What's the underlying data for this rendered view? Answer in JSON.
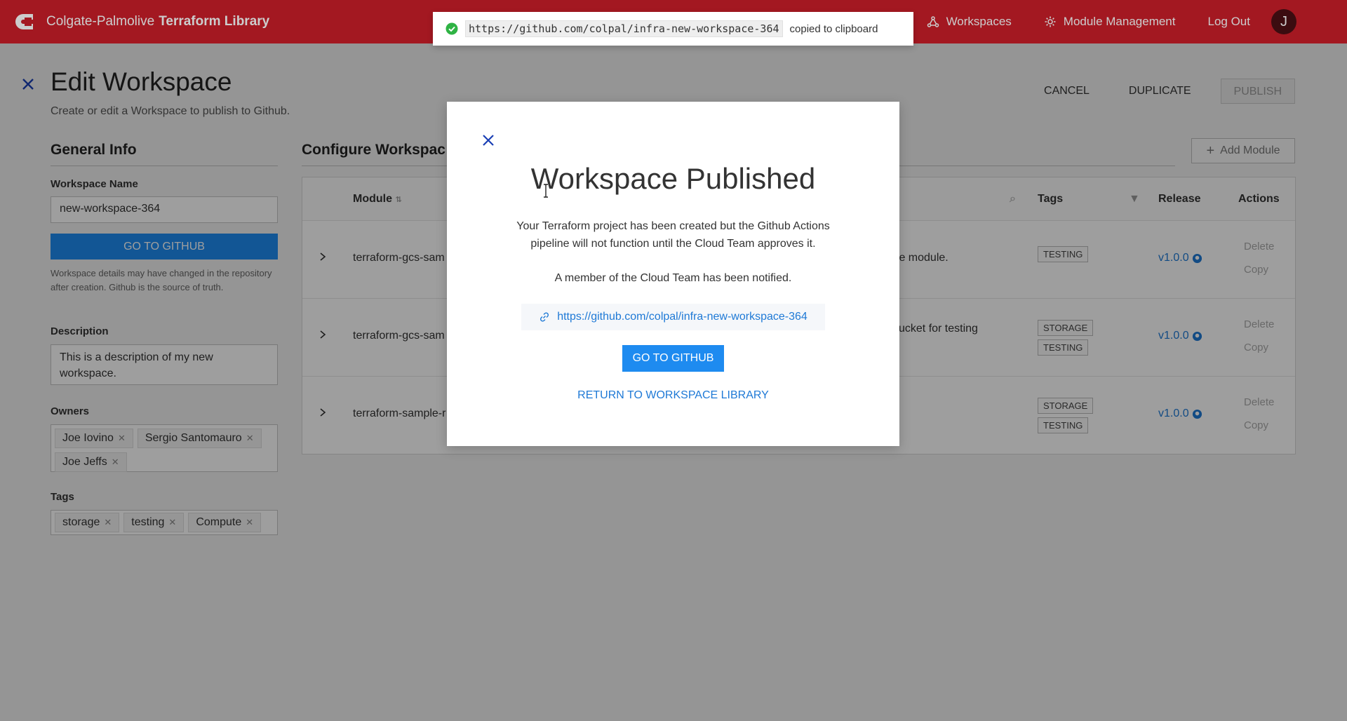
{
  "header": {
    "brand_prefix": "Colgate-Palmolive",
    "brand_bold": "Terraform Library",
    "nav": [
      {
        "label": "Workspaces",
        "icon": "workspaces-icon"
      },
      {
        "label": "Module Management",
        "icon": "gear-icon"
      },
      {
        "label": "Log Out"
      }
    ],
    "avatar_initial": "J",
    "brand_color": "#cc1f2a"
  },
  "page": {
    "title": "Edit Workspace",
    "subtitle": "Create or edit a Workspace to publish to Github.",
    "actions": {
      "cancel": "CANCEL",
      "duplicate": "DUPLICATE",
      "publish": "PUBLISH"
    }
  },
  "general": {
    "title": "General Info",
    "name_label": "Workspace Name",
    "name_value": "new-workspace-364",
    "github_button": "GO TO GITHUB",
    "help": "Workspace details may have changed in the repository after creation. Github is the source of truth.",
    "description_label": "Description",
    "description_value": "This is a description of my new workspace.",
    "owners_label": "Owners",
    "owners": [
      "Joe Iovino",
      "Sergio Santomauro",
      "Joe Jeffs"
    ],
    "tags_label": "Tags",
    "tags": [
      "storage",
      "testing",
      "Compute"
    ]
  },
  "configure": {
    "title": "Configure Workspac",
    "add_module": "Add Module",
    "columns": {
      "module": "Module",
      "tags": "Tags",
      "release": "Release",
      "actions": "Actions"
    },
    "rows": [
      {
        "module": "terraform-gcs-sam",
        "desc": "ple module.",
        "tags": [
          "TESTING"
        ],
        "release": "v1.0.0",
        "delete": "Delete",
        "copy": "Copy"
      },
      {
        "module": "terraform-gcs-sam",
        "desc": "ucket for testing",
        "tags": [
          "STORAGE",
          "TESTING"
        ],
        "release": "v1.0.0",
        "delete": "Delete",
        "copy": "Copy"
      },
      {
        "module": "terraform-sample-r",
        "desc": "",
        "tags": [
          "STORAGE",
          "TESTING"
        ],
        "release": "v1.0.0",
        "delete": "Delete",
        "copy": "Copy"
      }
    ]
  },
  "toast": {
    "url": "https://github.com/colpal/infra-new-workspace-364",
    "message": "copied to clipboard",
    "status_color": "#2fb344"
  },
  "modal": {
    "title": "Workspace Published",
    "body": "Your Terraform project has been created but the Github Actions pipeline will not function until the Cloud Team approves it.",
    "note": "A member of the Cloud Team has been notified.",
    "url": "https://github.com/colpal/infra-new-workspace-364",
    "github_button": "GO TO GITHUB",
    "return_link": "RETURN TO WORKSPACE LIBRARY"
  }
}
